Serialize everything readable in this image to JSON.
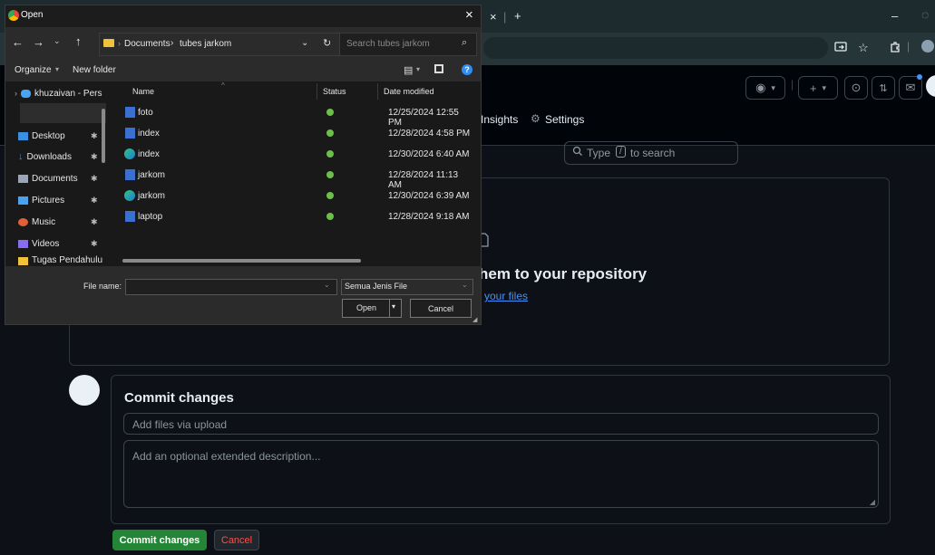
{
  "colors": {
    "gh_bg": "#0d1117",
    "gh_border": "#30363d",
    "gh_link": "#4493f8",
    "commit_green": "#238636",
    "cancel_red": "#da3633",
    "synced_green": "#6cc04a"
  },
  "browser": {
    "tab_close": "×",
    "tab_separator": "|",
    "new_tab": "+",
    "minimize": "–",
    "omnibox_icons": [
      "screen-cast-icon",
      "star-icon",
      "extensions-icon"
    ]
  },
  "github": {
    "search_placeholder": "Type",
    "search_key": "/",
    "search_suffix": "to search",
    "nav": {
      "insights": "Insights",
      "settings": "Settings"
    },
    "upload": {
      "heading": "hem to your repository",
      "link": "your files"
    },
    "commit": {
      "heading": "Commit changes",
      "summary_placeholder": "Add files via upload",
      "description_placeholder": "Add an optional extended description...",
      "commit_button": "Commit changes",
      "cancel_button": "Cancel"
    }
  },
  "dialog": {
    "title": "Open",
    "close": "×",
    "breadcrumb": {
      "part1": "Documents",
      "sep": "›",
      "part2": "tubes jarkom"
    },
    "search_placeholder": "Search tubes jarkom",
    "organize": "Organize",
    "new_folder": "New folder",
    "sidebar": [
      {
        "label": "khuzaivan - Pers",
        "icon": "cloud-icon",
        "color": "#4aa3f0"
      },
      {
        "label": "Desktop",
        "icon": "desktop-icon",
        "color": "#3b8ee0"
      },
      {
        "label": "Downloads",
        "icon": "download-icon",
        "color": "#3b8ee0"
      },
      {
        "label": "Documents",
        "icon": "documents-icon",
        "color": "#9aa6b8"
      },
      {
        "label": "Pictures",
        "icon": "pictures-icon",
        "color": "#4aa3f0"
      },
      {
        "label": "Music",
        "icon": "music-icon",
        "color": "#e0603b"
      },
      {
        "label": "Videos",
        "icon": "videos-icon",
        "color": "#8a6cf0"
      },
      {
        "label": "Tugas Pendahulu",
        "icon": "folder-icon",
        "color": "#f0c23b"
      }
    ],
    "columns": {
      "name": "Name",
      "status": "Status",
      "date": "Date modified"
    },
    "files": [
      {
        "name": "foto",
        "icon": "word-doc-icon",
        "date": "12/25/2024 12:55 PM"
      },
      {
        "name": "index",
        "icon": "word-doc-icon",
        "date": "12/28/2024 4:58 PM"
      },
      {
        "name": "index",
        "icon": "edge-html-icon",
        "date": "12/30/2024 6:40 AM"
      },
      {
        "name": "jarkom",
        "icon": "word-doc-icon",
        "date": "12/28/2024 11:13 AM"
      },
      {
        "name": "jarkom",
        "icon": "edge-html-icon",
        "date": "12/30/2024 6:39 AM"
      },
      {
        "name": "laptop",
        "icon": "word-doc-icon",
        "date": "12/28/2024 9:18 AM"
      }
    ],
    "file_name_label": "File name:",
    "file_type": "Semua Jenis File",
    "open_button": "Open",
    "cancel_button": "Cancel"
  }
}
